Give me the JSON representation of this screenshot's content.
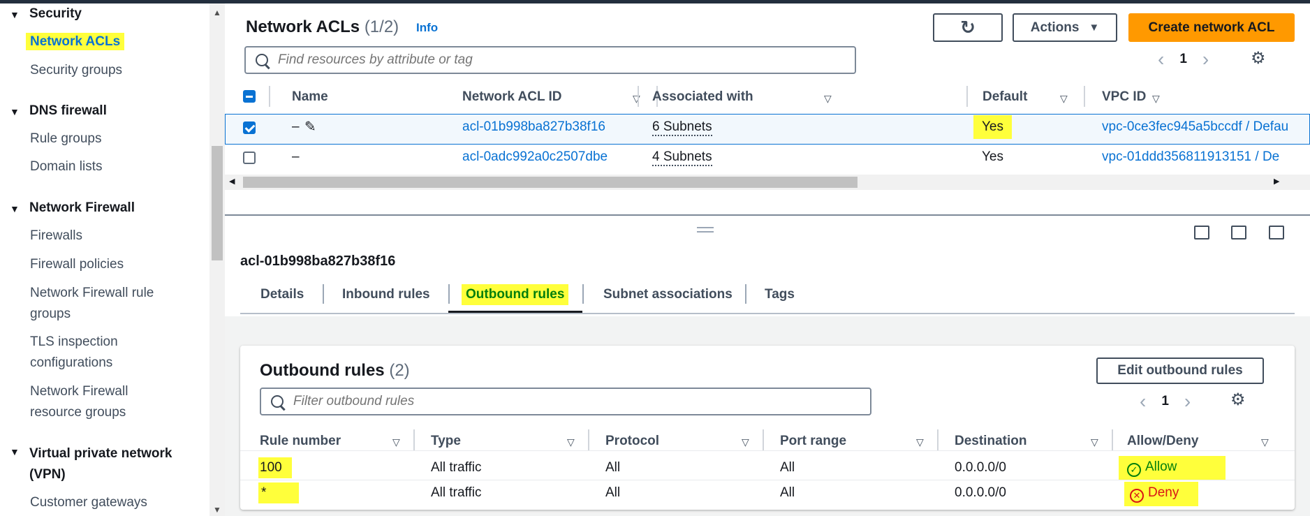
{
  "sidebar": {
    "sections": [
      {
        "title": "Security",
        "items": [
          "Network ACLs",
          "Security groups"
        ]
      },
      {
        "title": "DNS firewall",
        "items": [
          "Rule groups",
          "Domain lists"
        ]
      },
      {
        "title": "Network Firewall",
        "items": [
          "Firewalls",
          "Firewall policies",
          "Network Firewall rule groups",
          "TLS inspection configurations",
          "Network Firewall resource groups"
        ]
      },
      {
        "title": "Virtual private network (VPN)",
        "items": [
          "Customer gateways"
        ]
      }
    ],
    "s0": "Security",
    "s0i0": "Network ACLs",
    "s0i1": "Security groups",
    "s1": "DNS firewall",
    "s1i0": "Rule groups",
    "s1i1": "Domain lists",
    "s2": "Network Firewall",
    "s2i0": "Firewalls",
    "s2i1": "Firewall policies",
    "s2i2a": "Network Firewall rule",
    "s2i2b": "groups",
    "s2i3a": "TLS inspection",
    "s2i3b": "configurations",
    "s2i4a": "Network Firewall",
    "s2i4b": "resource groups",
    "s3a": "Virtual private network",
    "s3b": "(VPN)",
    "s3i0": "Customer gateways"
  },
  "header": {
    "title": "Network ACLs",
    "count": "(1/2)",
    "info": "Info",
    "actions": "Actions",
    "create": "Create network ACL",
    "search_placeholder": "Find resources by attribute or tag",
    "page": "1"
  },
  "acl_table": {
    "columns": [
      "Name",
      "Network ACL ID",
      "Associated with",
      "Default",
      "VPC ID"
    ],
    "rows": [
      {
        "name": "–",
        "id": "acl-01b998ba827b38f16",
        "assoc": "6 Subnets",
        "default": "Yes",
        "vpc": "vpc-0ce3fec945a5bccdf / Defau"
      },
      {
        "name": "–",
        "id": "acl-0adc992a0c2507dbe",
        "assoc": "4 Subnets",
        "default": "Yes",
        "vpc": "vpc-01ddd356811913151 / De"
      }
    ]
  },
  "detail": {
    "acl_id": "acl-01b998ba827b38f16",
    "tabs": [
      "Details",
      "Inbound rules",
      "Outbound rules",
      "Subnet associations",
      "Tags"
    ],
    "panel_title": "Outbound rules",
    "panel_count": "(2)",
    "edit_button": "Edit outbound rules",
    "filter_placeholder": "Filter outbound rules",
    "page": "1",
    "columns": [
      "Rule number",
      "Type",
      "Protocol",
      "Port range",
      "Destination",
      "Allow/Deny"
    ],
    "rules": [
      {
        "rule": "100",
        "type": "All traffic",
        "protocol": "All",
        "port": "All",
        "dest": "0.0.0.0/0",
        "action": "Allow"
      },
      {
        "rule": "*",
        "type": "All traffic",
        "protocol": "All",
        "port": "All",
        "dest": "0.0.0.0/0",
        "action": "Deny"
      }
    ]
  },
  "colors": {
    "accent": "#0972d3",
    "primary": "#ff9900",
    "highlight": "#ffff3b",
    "allow": "#037f0c",
    "deny": "#d91515"
  }
}
